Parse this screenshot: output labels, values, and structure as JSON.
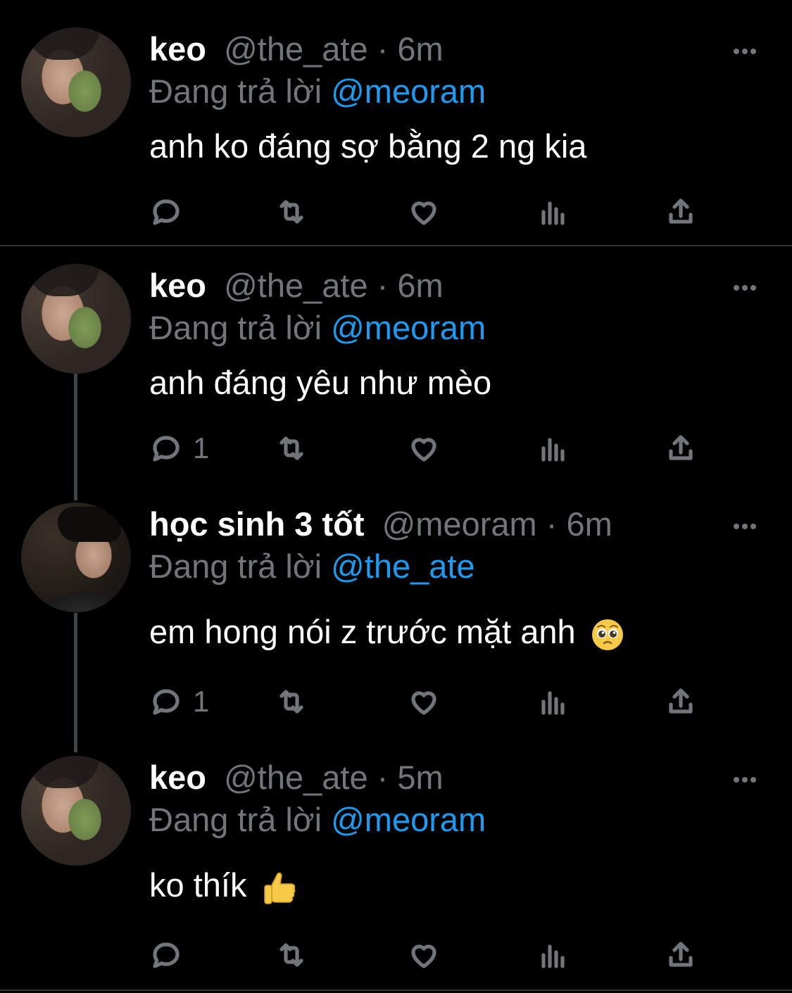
{
  "tweets": [
    {
      "name": "keo",
      "handle": "@the_ate",
      "time": "6m",
      "reply_prefix": "Đang trả lời",
      "reply_to": "@meoram",
      "text": "anh ko đáng sợ bằng 2 ng kia",
      "reply_count": "",
      "emoji": ""
    },
    {
      "name": "keo",
      "handle": "@the_ate",
      "time": "6m",
      "reply_prefix": "Đang trả lời",
      "reply_to": "@meoram",
      "text": "anh đáng yêu như mèo",
      "reply_count": "1",
      "emoji": ""
    },
    {
      "name": "học sinh 3 tốt",
      "handle": "@meoram",
      "time": "6m",
      "reply_prefix": "Đang trả lời",
      "reply_to": "@the_ate",
      "text": "em hong nói z trước mặt anh",
      "reply_count": "1",
      "emoji": "pleading-face"
    },
    {
      "name": "keo",
      "handle": "@the_ate",
      "time": "5m",
      "reply_prefix": "Đang trả lời",
      "reply_to": "@meoram",
      "text": "ko thík",
      "reply_count": "",
      "emoji": "thumbs-up"
    }
  ],
  "colors": {
    "background": "#000000",
    "muted": "#71767b",
    "mention": "#1d9bf0",
    "divider": "#2f3336",
    "thread_line": "#3f4448"
  },
  "icons": [
    "reply-icon",
    "retweet-icon",
    "like-icon",
    "views-icon",
    "share-icon",
    "more-icon"
  ]
}
